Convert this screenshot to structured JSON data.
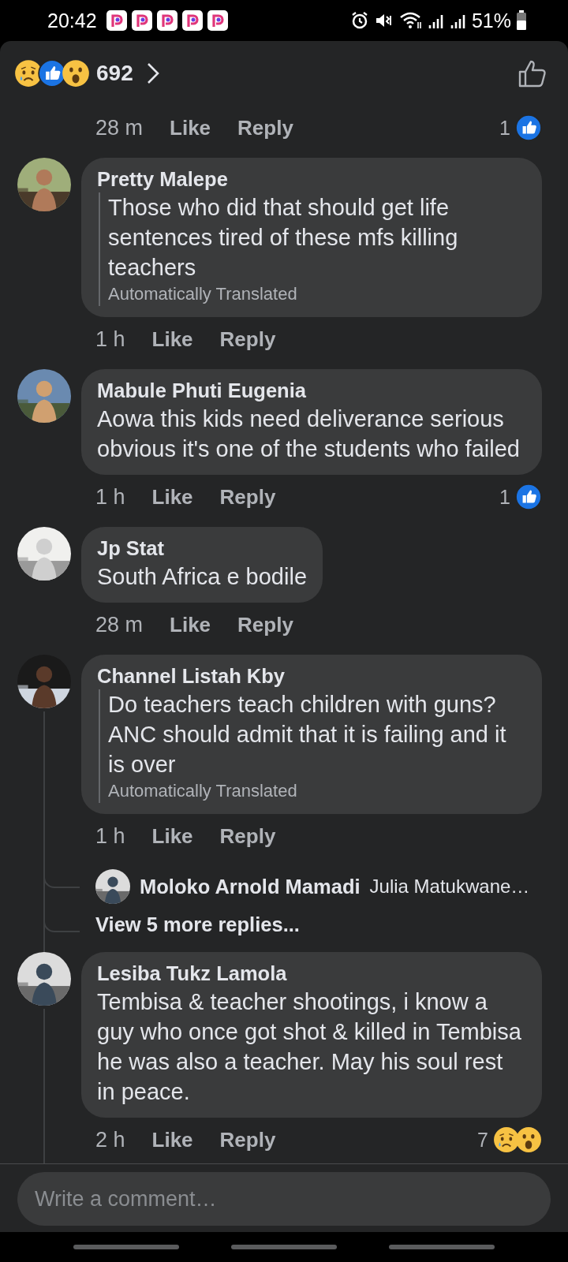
{
  "status_bar": {
    "time": "20:42",
    "battery": "51%"
  },
  "header": {
    "reactions": [
      {
        "kind": "sad"
      },
      {
        "kind": "like"
      },
      {
        "kind": "wow"
      }
    ],
    "reaction_count": "692"
  },
  "comments": [
    {
      "kind": "actions_only",
      "time": "28 m",
      "like": "Like",
      "reply": "Reply",
      "reaction_count": "1",
      "reactions": [
        {
          "kind": "like"
        }
      ],
      "threaded": false
    },
    {
      "kind": "comment",
      "name": "Pretty Malepe",
      "text": "Those who did that should get life sentences tired of these mfs killing teachers",
      "translated": "Automatically Translated",
      "time": "1 h",
      "like": "Like",
      "reply": "Reply",
      "threaded": false
    },
    {
      "kind": "comment",
      "name": "Mabule Phuti Eugenia",
      "text": "Aowa this kids need deliverance serious obvious it's one of the students who failed",
      "time": "1 h",
      "like": "Like",
      "reply": "Reply",
      "reaction_count": "1",
      "reactions": [
        {
          "kind": "like"
        }
      ],
      "threaded": false
    },
    {
      "kind": "comment",
      "name": "Jp Stat",
      "text": "South Africa e bodile",
      "time": "28 m",
      "like": "Like",
      "reply": "Reply",
      "threaded": false
    },
    {
      "kind": "comment",
      "name": "Channel Listah Kby",
      "text": "Do teachers teach children with guns? ANC should admit that it is failing and it is over",
      "translated": "Automatically Translated",
      "time": "1 h",
      "like": "Like",
      "reply": "Reply",
      "threaded": true,
      "replies": [
        {
          "name": "Moloko Arnold Mamadi",
          "text": "Julia Matukwane…"
        }
      ],
      "more_replies": "View 5 more replies..."
    },
    {
      "kind": "comment",
      "name": "Lesiba Tukz Lamola",
      "text": "Tembisa & teacher shootings, i know a guy who once got shot & killed in Tembisa he was also a teacher. May his soul rest in peace.",
      "time": "2 h",
      "like": "Like",
      "reply": "Reply",
      "reaction_count": "7",
      "reactions": [
        {
          "kind": "sad"
        },
        {
          "kind": "wow"
        }
      ],
      "threaded": true
    }
  ],
  "composer": {
    "placeholder": "Write a comment…"
  }
}
